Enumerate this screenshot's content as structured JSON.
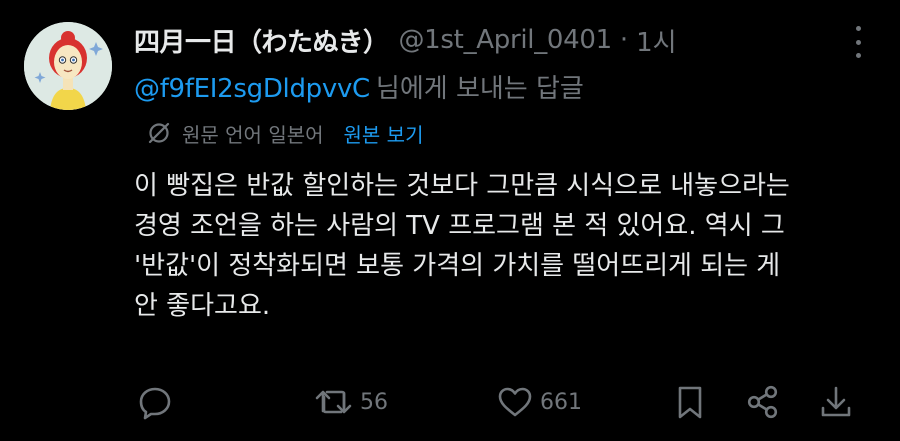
{
  "author": {
    "display_name": "四月一日（わたぬき）",
    "handle": "@1st_April_0401",
    "separator": "·",
    "time": "1시"
  },
  "reply": {
    "mention": "@f9fEI2sgDldpvvC",
    "suffix": "님에게 보내는 답글"
  },
  "translation": {
    "label": "원문 언어 일본어",
    "link": "원본 보기"
  },
  "body_lines": [
    "이 빵집은 반값 할인하는 것보다 그만큼 시식으로 내놓으라는",
    "경영 조언을 하는 사람의 TV 프로그램 본 적 있어요. 역시 그",
    "'반값'이 정착화되면 보통 가격의 가치를 떨어뜨리게 되는 게",
    "안 좋다고요."
  ],
  "actions": {
    "reply_icon": "comment-icon",
    "retweet_icon": "retweet-icon",
    "retweet_count": "56",
    "like_icon": "heart-icon",
    "like_count": "661",
    "bookmark_icon": "bookmark-icon",
    "share_icon": "share-icon",
    "download_icon": "download-icon"
  },
  "colors": {
    "background": "#000000",
    "text_primary": "#e7e9ea",
    "text_secondary": "#71767b",
    "accent": "#1d9bf0"
  }
}
